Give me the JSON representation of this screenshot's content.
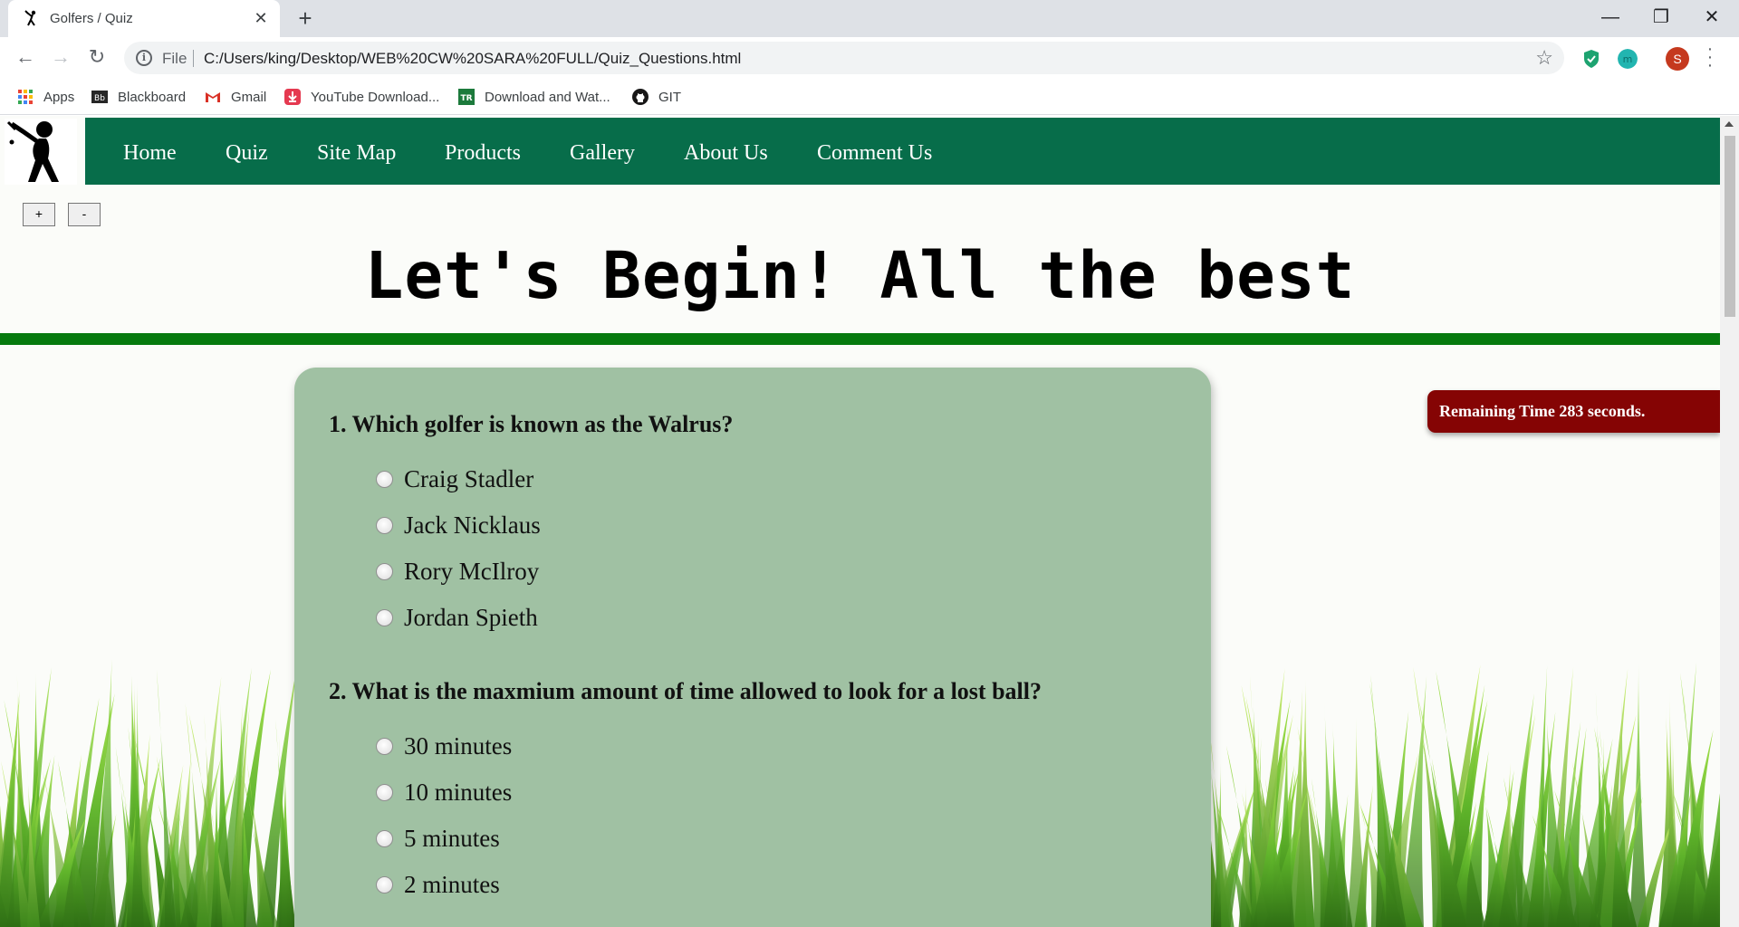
{
  "browser": {
    "tab_title": "Golfers / Quiz",
    "scheme": "File",
    "url": "C:/Users/king/Desktop/WEB%20CW%20SARA%20FULL/Quiz_Questions.html",
    "profile_initial": "S",
    "bookmarks": [
      "Apps",
      "Blackboard",
      "Gmail",
      "YouTube Download...",
      "Download and Wat...",
      "GIT"
    ]
  },
  "nav": {
    "items": [
      "Home",
      "Quiz",
      "Site Map",
      "Products",
      "Gallery",
      "About Us",
      "Comment Us"
    ]
  },
  "zoom": {
    "plus": "+",
    "minus": "-"
  },
  "heading": "Let's Begin! All the best",
  "timer": "Remaining Time 283 seconds.",
  "quiz": {
    "questions": [
      {
        "text": "1. Which golfer is known as the Walrus?",
        "options": [
          "Craig Stadler",
          "Jack Nicklaus",
          "Rory McIlroy",
          "Jordan Spieth"
        ]
      },
      {
        "text": "2. What is the maxmium amount of time allowed to look for a lost ball?",
        "options": [
          "30 minutes",
          "10 minutes",
          "5 minutes",
          "2 minutes"
        ]
      }
    ]
  },
  "colors": {
    "navbar": "#076d4a",
    "rule": "#067a0e",
    "card": "#a0c1a3",
    "timer": "#850404"
  }
}
